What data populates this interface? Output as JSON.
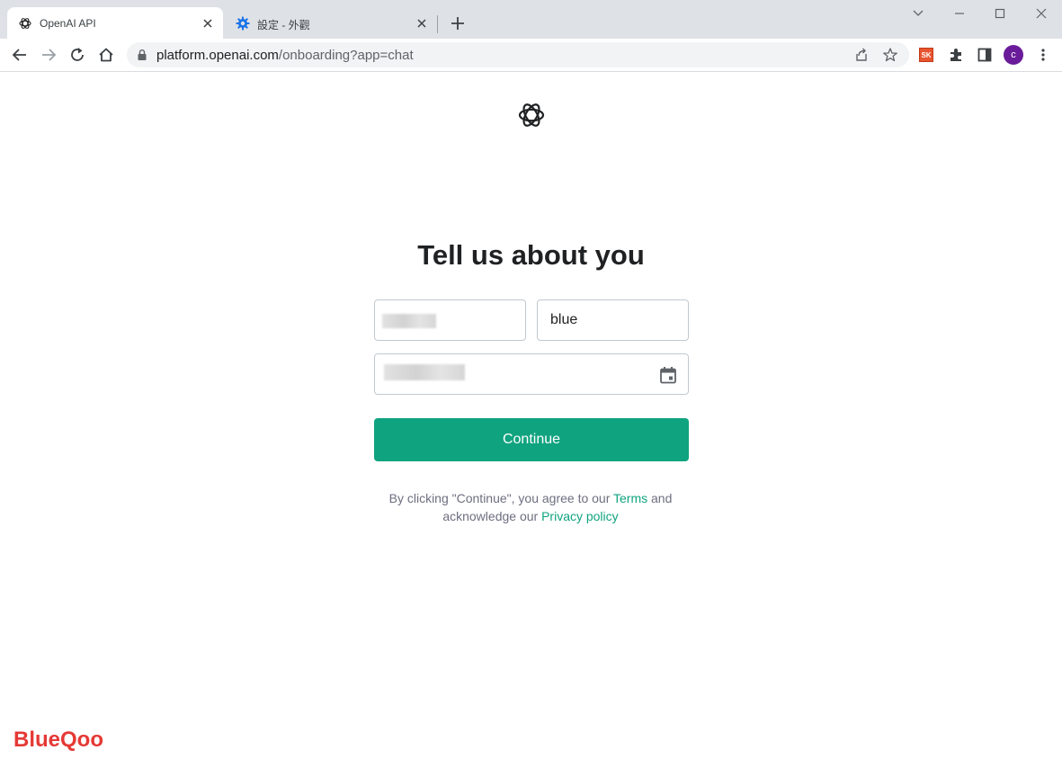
{
  "browser": {
    "tabs": [
      {
        "title": "OpenAI API",
        "active": true
      },
      {
        "title": "設定 - 外觀",
        "active": false
      }
    ],
    "url": {
      "host": "platform.openai.com",
      "path": "/onboarding?app=chat"
    },
    "profile_initial": "c",
    "extension_sk_label": "SK"
  },
  "page": {
    "heading": "Tell us about you",
    "form": {
      "first_name_value": "",
      "last_name_value": "blue",
      "birthday_value": ""
    },
    "continue_label": "Continue",
    "legal": {
      "before_terms": "By clicking \"Continue\", you agree to our ",
      "terms_link": "Terms",
      "after_terms": " and acknowledge our ",
      "privacy_link": "Privacy policy"
    }
  },
  "watermark": "BlueQoo",
  "colors": {
    "accent": "#10a37f",
    "tabstrip": "#dee1e6",
    "profile": "#6a1b9a",
    "watermark": "#e53935"
  },
  "icons": [
    "openai-logo-icon",
    "gear-icon",
    "close-icon",
    "plus-icon",
    "chevron-down-icon",
    "minimize-icon",
    "maximize-icon",
    "window-close-icon",
    "back-arrow-icon",
    "forward-arrow-icon",
    "reload-icon",
    "home-icon",
    "lock-icon",
    "share-icon",
    "star-icon",
    "puzzle-icon",
    "side-panel-icon",
    "kebab-menu-icon",
    "calendar-icon"
  ]
}
